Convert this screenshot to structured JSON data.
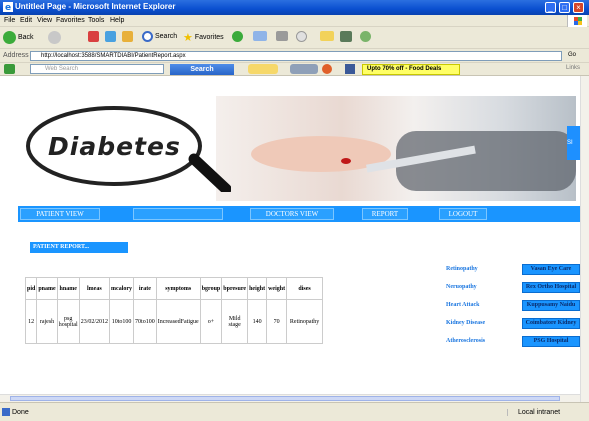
{
  "window": {
    "title": "Untitled Page - Microsoft Internet Explorer"
  },
  "menu": [
    "File",
    "Edit",
    "View",
    "Favorites",
    "Tools",
    "Help"
  ],
  "toolbar": {
    "back_label": "Back",
    "search_label": "Search",
    "favorites_label": "Favorites"
  },
  "address": {
    "label": "Address",
    "url": "http://localhost:3588/SMARTDIABI/PatientReport.aspx",
    "go_label": "Go"
  },
  "searchbar": {
    "placeholder": "Web Search",
    "search_button": "Search",
    "deal": "Upto 70% off - Food Deals",
    "links_label": "Links"
  },
  "banner": {
    "word": "Diabetes"
  },
  "nav": [
    "PATIENT VIEW",
    "",
    "DOCTORS VIEW",
    "REPORT",
    "LOGOUT"
  ],
  "section_label": "PATIENT REPORT...",
  "table": {
    "headers": [
      "pid",
      "pname",
      "hname",
      "lmeas",
      "mcalory",
      "irate",
      "symptoms",
      "bgroup",
      "bpresure",
      "height",
      "weight",
      "dises"
    ],
    "rows": [
      [
        "12",
        "rajesh",
        "psg hospital",
        "23/02/2012",
        "10to100",
        "70to100",
        "IncreasedFatigue",
        "o+",
        "Mild stage",
        "140",
        "70",
        "Retinopathy"
      ]
    ]
  },
  "side_links": [
    {
      "disease": "Retinopathy",
      "hospital": "Vasan Eye Care"
    },
    {
      "disease": "Neruopathy",
      "hospital": "Rex Ortho Hospital"
    },
    {
      "disease": "Heart Attack",
      "hospital": "Kuppusamy Naidu"
    },
    {
      "disease": "Kidney Disease",
      "hospital": "Coimbatore Kidney"
    },
    {
      "disease": "Atherosclerosis",
      "hospital": "PSG Hospital"
    }
  ],
  "status": {
    "left": "Done",
    "zone": "Local intranet"
  },
  "colors": {
    "nav_blue": "#1a95ff",
    "title_blue": "#0a4fd0",
    "link_blue": "#1a76e0"
  }
}
